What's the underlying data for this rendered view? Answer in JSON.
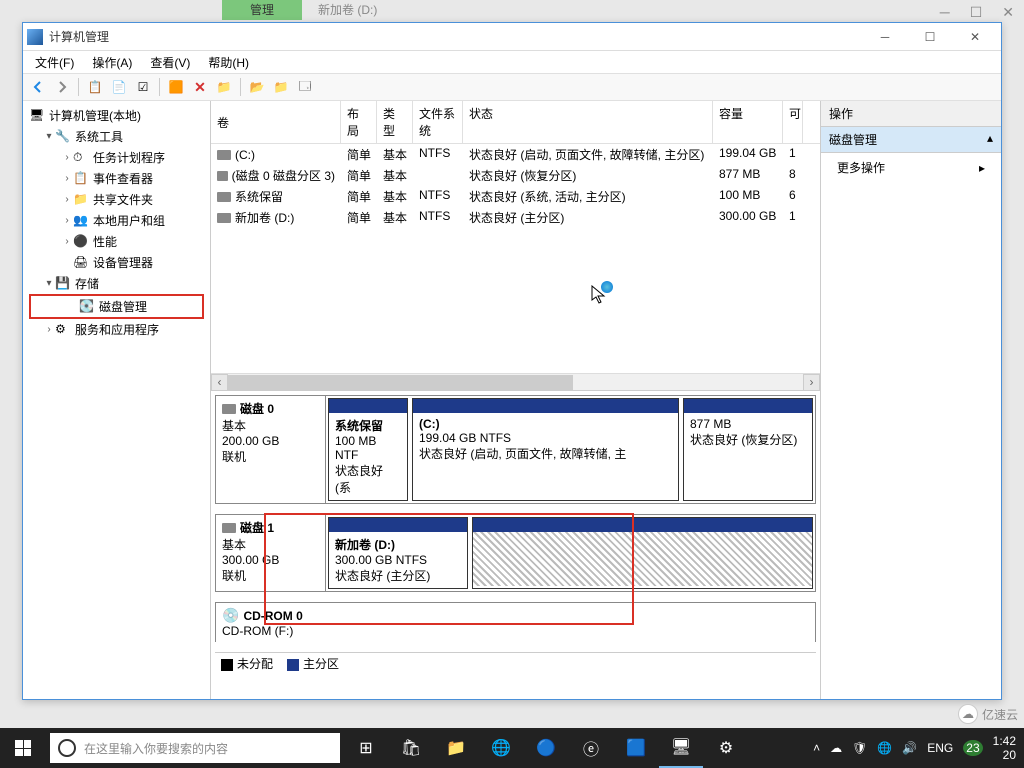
{
  "bg_tabs": {
    "manage": "管理",
    "new_volume": "新加卷 (D:)"
  },
  "window": {
    "title": "计算机管理"
  },
  "menu": {
    "file": "文件(F)",
    "action": "操作(A)",
    "view": "查看(V)",
    "help": "帮助(H)"
  },
  "tree": {
    "root": "计算机管理(本地)",
    "system_tools": "系统工具",
    "task_scheduler": "任务计划程序",
    "event_viewer": "事件查看器",
    "shared_folders": "共享文件夹",
    "local_users": "本地用户和组",
    "performance": "性能",
    "device_manager": "设备管理器",
    "storage": "存储",
    "disk_management": "磁盘管理",
    "services_apps": "服务和应用程序"
  },
  "columns": {
    "volume": "卷",
    "layout": "布局",
    "type": "类型",
    "fs": "文件系统",
    "status": "状态",
    "capacity": "容量",
    "free": "可"
  },
  "volumes": [
    {
      "name": "(C:)",
      "layout": "简单",
      "type": "基本",
      "fs": "NTFS",
      "status": "状态良好 (启动, 页面文件, 故障转储, 主分区)",
      "capacity": "199.04 GB",
      "free": "1"
    },
    {
      "name": "(磁盘 0 磁盘分区 3)",
      "layout": "简单",
      "type": "基本",
      "fs": "",
      "status": "状态良好 (恢复分区)",
      "capacity": "877 MB",
      "free": "8"
    },
    {
      "name": "系统保留",
      "layout": "简单",
      "type": "基本",
      "fs": "NTFS",
      "status": "状态良好 (系统, 活动, 主分区)",
      "capacity": "100 MB",
      "free": "6"
    },
    {
      "name": "新加卷 (D:)",
      "layout": "简单",
      "type": "基本",
      "fs": "NTFS",
      "status": "状态良好 (主分区)",
      "capacity": "300.00 GB",
      "free": "1"
    }
  ],
  "disks": {
    "disk0": {
      "title": "磁盘 0",
      "type": "基本",
      "size": "200.00 GB",
      "status": "联机"
    },
    "disk0_parts": {
      "p1": {
        "title": "系统保留",
        "line2": "100 MB NTF",
        "line3": "状态良好 (系"
      },
      "p2": {
        "title": "(C:)",
        "line2": "199.04 GB NTFS",
        "line3": "状态良好 (启动, 页面文件, 故障转储, 主"
      },
      "p3": {
        "title": "",
        "line2": "877 MB",
        "line3": "状态良好 (恢复分区)"
      }
    },
    "disk1": {
      "title": "磁盘 1",
      "type": "基本",
      "size": "300.00 GB",
      "status": "联机"
    },
    "disk1_parts": {
      "p1": {
        "title": "新加卷  (D:)",
        "line2": "300.00 GB NTFS",
        "line3": "状态良好 (主分区)"
      }
    },
    "cdrom": {
      "title": "CD-ROM 0",
      "sub": "CD-ROM (F:)"
    }
  },
  "legend": {
    "unallocated": "未分配",
    "primary": "主分区"
  },
  "actions": {
    "header": "操作",
    "disk_mgmt": "磁盘管理",
    "more": "更多操作"
  },
  "taskbar": {
    "search_placeholder": "在这里输入你要搜索的内容",
    "lang": "ENG",
    "date_num": "23",
    "time": "1:42",
    "date2": "20"
  },
  "watermark": "亿速云"
}
